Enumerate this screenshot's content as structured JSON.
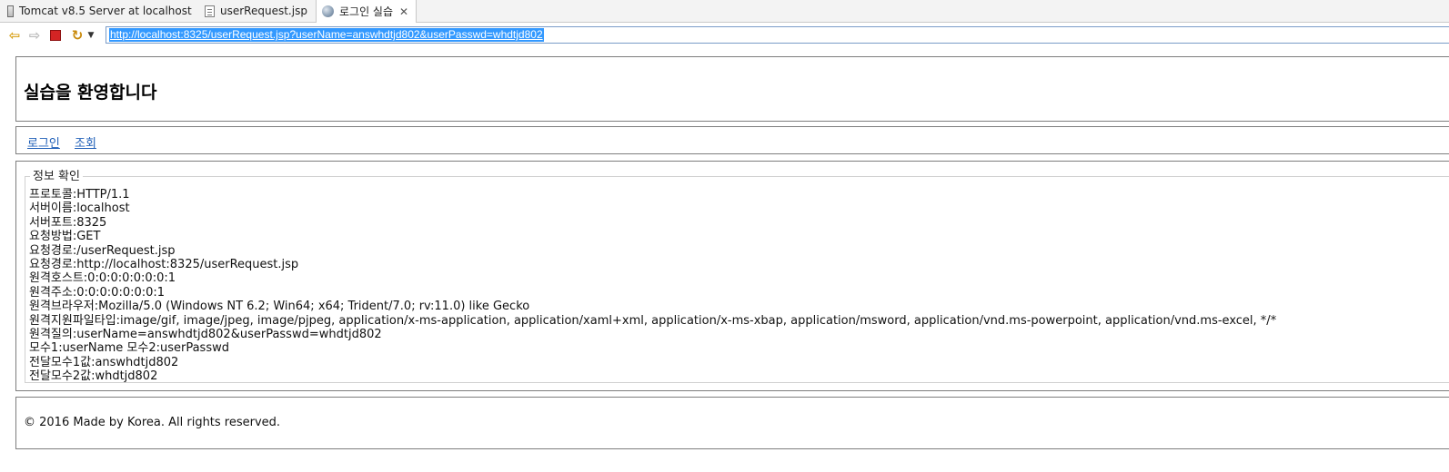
{
  "tabs": [
    {
      "label": "Tomcat v8.5 Server at localhost",
      "icon": "server-icon"
    },
    {
      "label": "userRequest.jsp",
      "icon": "jsp-file-icon"
    },
    {
      "label": "로그인 실습",
      "icon": "globe-icon",
      "close": "✕"
    }
  ],
  "toolbar": {
    "url": "http://localhost:8325/userRequest.jsp?userName=answhdtjd802&userPasswd=whdtjd802"
  },
  "page": {
    "title": "실습을 환영합니다",
    "nav": [
      "로그인",
      "조회"
    ],
    "legend": "정보 확인",
    "lines": [
      "프로토콜:HTTP/1.1",
      "서버이름:localhost",
      "서버포트:8325",
      "요청방법:GET",
      "요청경로:/userRequest.jsp",
      "요청경로:http://localhost:8325/userRequest.jsp",
      "원격호스트:0:0:0:0:0:0:0:1",
      "원격주소:0:0:0:0:0:0:0:1",
      "원격브라우저:Mozilla/5.0 (Windows NT 6.2; Win64; x64; Trident/7.0; rv:11.0) like Gecko",
      "원격지원파일타입:image/gif, image/jpeg, image/pjpeg, application/x-ms-application, application/xaml+xml, application/x-ms-xbap, application/msword, application/vnd.ms-powerpoint, application/vnd.ms-excel, */*",
      "원격질의:userName=answhdtjd802&userPasswd=whdtjd802",
      "모수1:userName 모수2:userPasswd",
      "전달모수1값:answhdtjd802",
      "전달모수2값:whdtjd802"
    ],
    "footer": "© 2016 Made by Korea. All rights reserved."
  }
}
